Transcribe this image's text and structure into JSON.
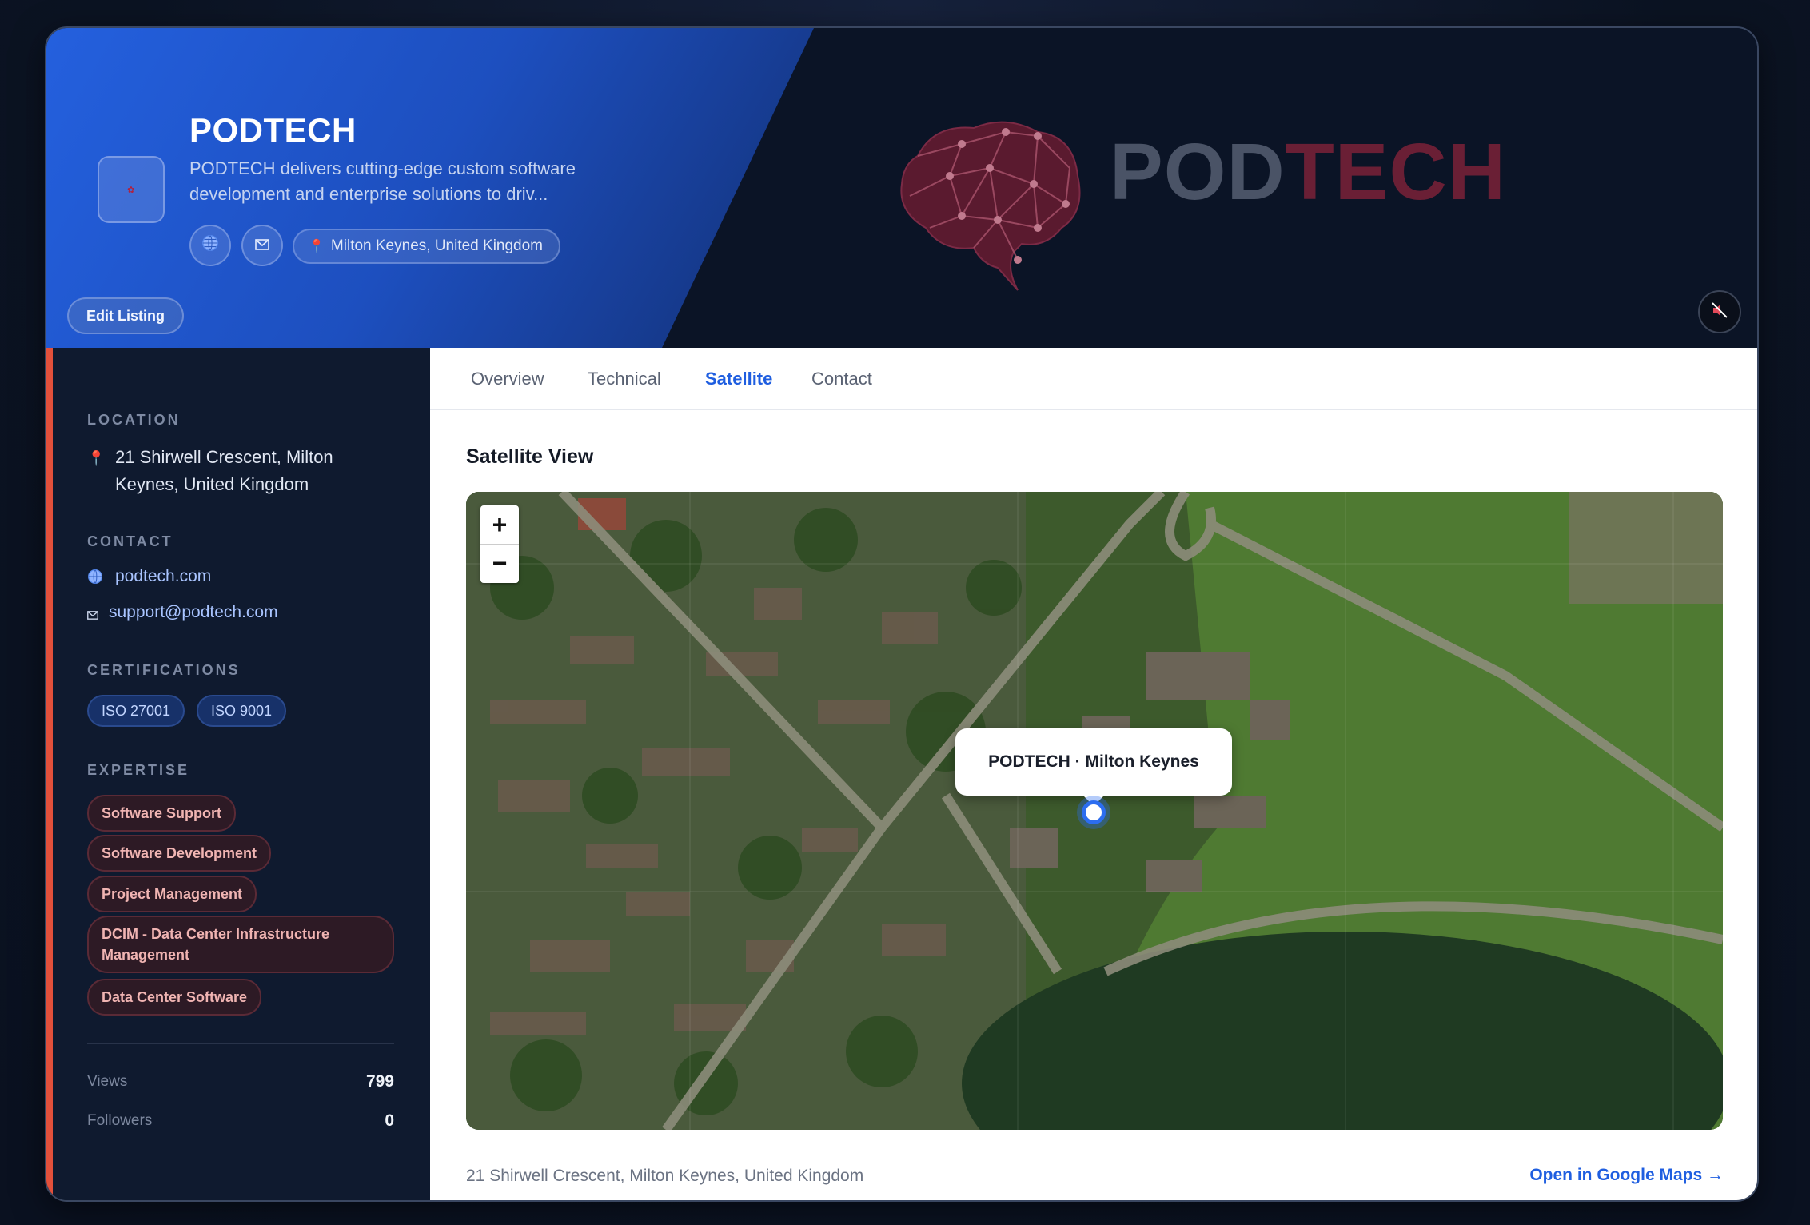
{
  "header": {
    "company_name": "PODTECH",
    "description": "PODTECH delivers cutting-edge custom software development and enterprise solutions to driv...",
    "logo_text_pod": "POD",
    "logo_text_tech": "TECH",
    "location": "Milton Keynes, United Kingdom",
    "edit_label": "Edit Listing",
    "icons": {
      "website": "globe-icon",
      "email": "envelope-icon",
      "location": "map-pin-icon",
      "mute": "speaker-muted-icon"
    }
  },
  "sidebar": {
    "location_label": "LOCATION",
    "address": "21 Shirwell Crescent, Milton Keynes, United Kingdom",
    "contact_label": "CONTACT",
    "website": "podtech.com",
    "email": "support@podtech.com",
    "certifications_label": "CERTIFICATIONS",
    "certifications": [
      "ISO 27001",
      "ISO 9001"
    ],
    "expertise_label": "EXPERTISE",
    "expertise": [
      "Software Support",
      "Software Development",
      "Project Management",
      "DCIM - Data Center Infrastructure Management",
      "Data Center Software"
    ],
    "stats": [
      {
        "label": "Views",
        "value": "799"
      },
      {
        "label": "Followers",
        "value": "0"
      }
    ]
  },
  "main": {
    "tabs": [
      "Overview",
      "Technical",
      "Satellite",
      "Contact"
    ],
    "active_tab": "Satellite",
    "section_title": "Satellite View",
    "map": {
      "zoom_in": "+",
      "zoom_out": "−",
      "popup_label": "PODTECH · Milton Keynes"
    },
    "footer_address": "21 Shirwell Crescent, Milton Keynes, United Kingdom",
    "open_maps_label": "Open in Google Maps →"
  },
  "colors": {
    "accent": "#1f5ee0",
    "sidebar_accent": "#e2503b",
    "brand_red": "#6a1f35"
  }
}
